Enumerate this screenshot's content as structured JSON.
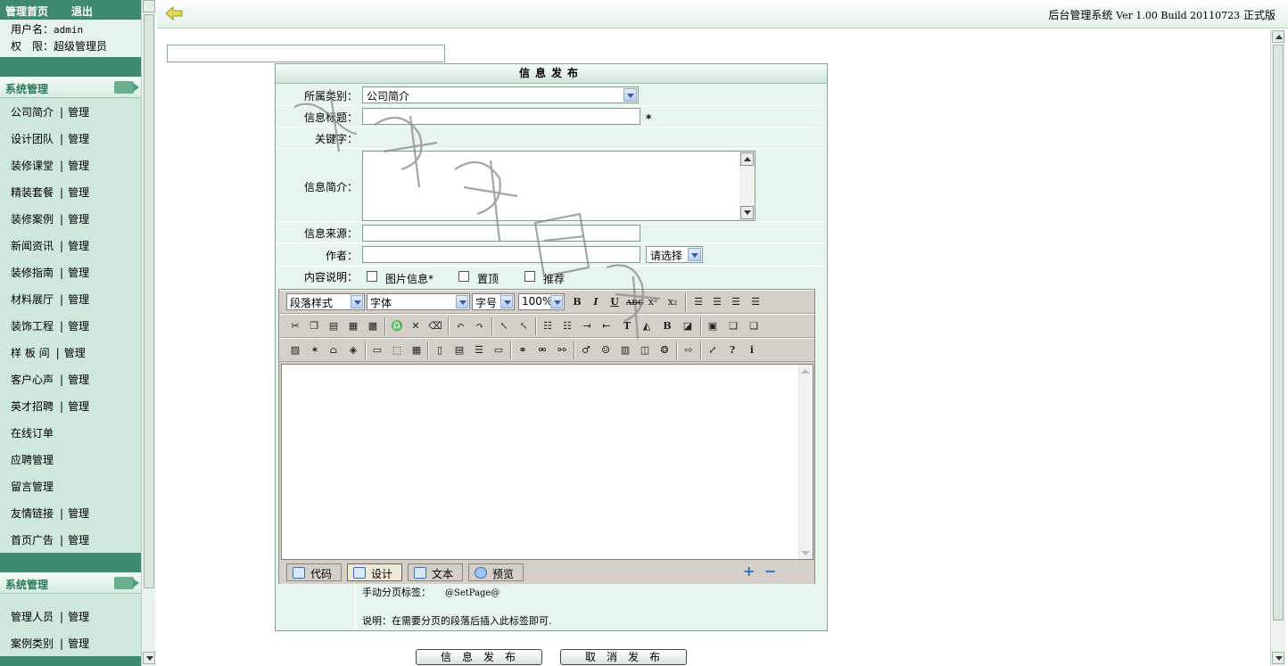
{
  "sidebar": {
    "top_home": "管理首页",
    "top_logout": "退出",
    "user_label": "用户名：",
    "user_value": "admin",
    "perm_label": "权　限：",
    "perm_value": "超级管理员",
    "section1_title": "系统管理",
    "section2_title": "系统管理",
    "manage_label": "管理",
    "section1_items": [
      {
        "label": "公司简介",
        "manage": true
      },
      {
        "label": "设计团队",
        "manage": true
      },
      {
        "label": "装修课堂",
        "manage": true
      },
      {
        "label": "精装套餐",
        "manage": true
      },
      {
        "label": "装修案例",
        "manage": true
      },
      {
        "label": "新闻资讯",
        "manage": true
      },
      {
        "label": "装修指南",
        "manage": true
      },
      {
        "label": "材料展厅",
        "manage": true
      },
      {
        "label": "装饰工程",
        "manage": true
      },
      {
        "label": "样 板 间",
        "manage": true
      },
      {
        "label": "客户心声",
        "manage": true
      },
      {
        "label": "英才招聘",
        "manage": true
      },
      {
        "label": "在线订单",
        "manage": false
      },
      {
        "label": "应聘管理",
        "manage": false
      },
      {
        "label": "留言管理",
        "manage": false
      },
      {
        "label": "友情链接",
        "manage": true
      },
      {
        "label": "首页广告",
        "manage": true
      }
    ],
    "section2_items": [
      {
        "label": "管理人员",
        "manage": true
      },
      {
        "label": "案例类别",
        "manage": true
      }
    ]
  },
  "header": {
    "version_prefix": "后台管理系统",
    "version_mono": "Ver 1.00 Build 20110723",
    "version_suffix": "正式版"
  },
  "form": {
    "title": "信息发布",
    "category_label": "所属类别：",
    "category_value": "公司简介",
    "title_label": "信息标题：",
    "title_required": "*",
    "keyword_label": "关键字：",
    "summary_label": "信息简介：",
    "source_label": "信息来源：",
    "author_label": "作者：",
    "author_select": "请选择",
    "content_label": "内容说明：",
    "check_image": "图片信息*",
    "check_top": "置顶",
    "check_recommend": "推荐"
  },
  "editor": {
    "para_style": "段落样式",
    "font": "字体",
    "font_size": "字号",
    "zoom": "100%",
    "tabs": [
      "代码",
      "设计",
      "文本",
      "预览"
    ],
    "active_tab": "设计",
    "page_tag_label": "手动分页标签：",
    "page_tag": "@SetPage@",
    "page_note": "说明：在需要分页的段落后插入此标签即可."
  },
  "buttons": {
    "publish": "信息发布",
    "cancel": "取消发布"
  },
  "colors": {
    "sidebar_dark": "#3f8a6e",
    "sidebar_bg": "#cfe8dc",
    "form_bg": "#e8f4ee"
  }
}
